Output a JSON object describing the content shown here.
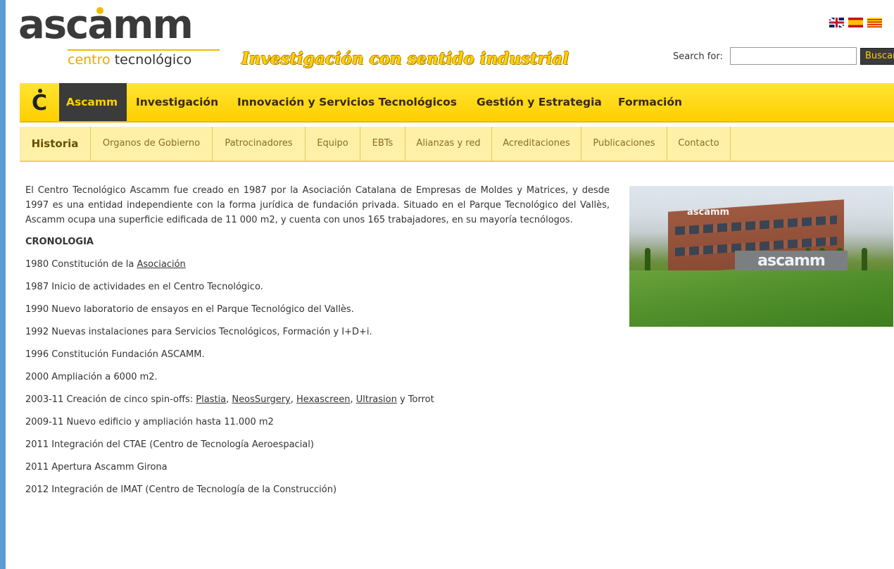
{
  "header": {
    "logo_word": "ascamm",
    "logo_sub_part1": "centro",
    "logo_sub_part2": " tecnológico",
    "slogan": "Investigación con sentido industrial",
    "search_label": "Search for:",
    "search_value": "",
    "search_button": "Buscar",
    "languages": [
      {
        "name": "english",
        "icon": "uk-flag-icon"
      },
      {
        "name": "español",
        "icon": "spain-flag-icon"
      },
      {
        "name": "català",
        "icon": "catalonia-flag-icon"
      }
    ]
  },
  "main_nav": {
    "icon_letter": "C",
    "items": [
      {
        "label": "Ascamm",
        "active": true
      },
      {
        "label": "Investigación"
      },
      {
        "label": "Innovación y Servicios Tecnológicos"
      },
      {
        "label": "Gestión y Estrategia"
      },
      {
        "label": "Formación"
      }
    ]
  },
  "sub_nav": {
    "items": [
      {
        "label": "Historia",
        "active": true
      },
      {
        "label": "Organos de Gobierno"
      },
      {
        "label": "Patrocinadores"
      },
      {
        "label": "Equipo"
      },
      {
        "label": "EBTs"
      },
      {
        "label": "Alianzas y red"
      },
      {
        "label": "Acreditaciones"
      },
      {
        "label": "Publicaciones"
      },
      {
        "label": "Contacto"
      }
    ]
  },
  "content": {
    "intro": "El Centro Tecnológico Ascamm fue creado en 1987 por la Asociación Catalana de Empresas de Moldes y Matrices, y desde 1997 es una entidad independiente con la forma jurídica de fundación privada. Situado en el Parque Tecnológico del Vallès, Ascamm ocupa una superficie edificada de 11 000 m2, y cuenta con unos 165 trabajadores, en su mayoría tecnólogos.",
    "cronologia_title": "CRONOLOGIA",
    "item_1980_text": "1980 Constitución de la ",
    "item_1980_link": "Asociación ",
    "items": [
      "1987 Inicio de actividades en el Centro Tecnológico.",
      "1990 Nuevo laboratorio de ensayos en el Parque Tecnológico del Vallès.",
      "1992 Nuevas instalaciones para Servicios Tecnológicos, Formación y I+D+i.",
      "1996 Constitución Fundación ASCAMM.",
      "2000 Ampliación a 6000 m2."
    ],
    "item_2003": {
      "prefix": "2003-11 Creación de cinco spin-offs: ",
      "links": [
        "Plastia",
        "NeosSurgery",
        "Hexascreen",
        "Ultrasion"
      ],
      "sep": ", ",
      "and": " y ",
      "last": "Torrot"
    },
    "items_after": [
      "2009-11 Nuevo edificio y ampliación hasta 11.000 m2",
      "2011 Integración del CTAE (Centro de Tecnología Aeroespacial)",
      "2011 Apertura Ascamm Girona",
      "2012 Integración de IMAT (Centro de Tecnología de la Construcción)"
    ],
    "photo": {
      "roof_text": "ascamm",
      "sign_text": "ascamm"
    }
  }
}
